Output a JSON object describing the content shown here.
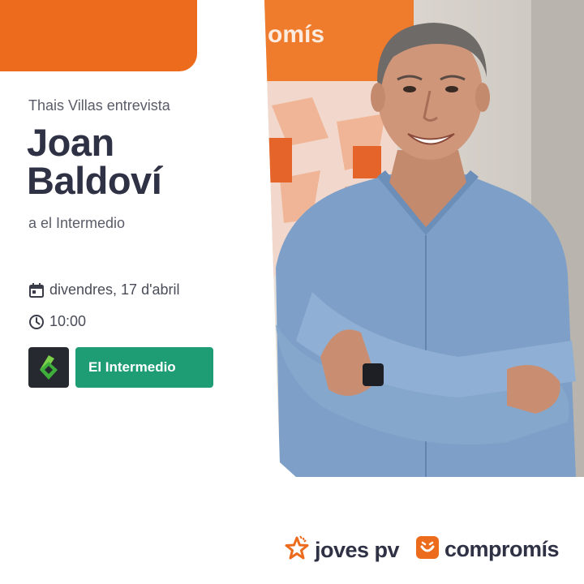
{
  "interviewer_line": "Thais Villas entrevista",
  "guest_name_line1": "Joan",
  "guest_name_line2": "Baldoví",
  "program_line": "a el Intermedio",
  "event": {
    "date": "divendres, 17 d'abril",
    "time": "10:00"
  },
  "cta_label": "El Intermedio",
  "footer": {
    "left_logo": "joves pv",
    "right_logo": "compromís"
  },
  "photo_sign_text": "omís",
  "colors": {
    "accent_orange": "#ec6b1c",
    "button_green": "#1e9c74",
    "dark_text": "#2f3145"
  },
  "icons": [
    "calendar-icon",
    "clock-icon",
    "star-logo-icon",
    "smile-logo-icon",
    "channel-6-logo"
  ]
}
